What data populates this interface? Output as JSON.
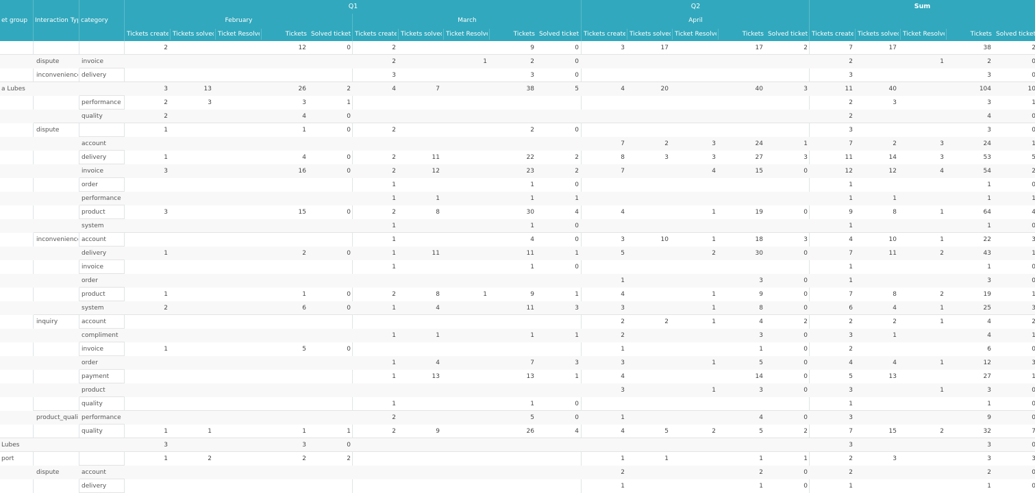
{
  "header": {
    "row_fields": [
      "et group",
      "Interaction Typ",
      "category"
    ],
    "quarters": [
      {
        "label": "Q1"
      },
      {
        "label": "Q2"
      },
      {
        "label": "Sum"
      }
    ],
    "months": [
      "February",
      "March",
      "April"
    ],
    "measures": [
      "Tickets created",
      "Tickets solved -",
      "Ticket Resolved",
      "Tickets",
      "Solved tickets"
    ]
  },
  "rows": [
    {
      "g": "",
      "t": "",
      "c": "",
      "v": [
        [
          "2",
          "",
          "",
          "12",
          "0"
        ],
        [
          "2",
          "",
          "",
          "9",
          "0"
        ],
        [
          "3",
          "17",
          "",
          "17",
          "2"
        ],
        [
          "7",
          "17",
          "",
          "38",
          "2"
        ]
      ]
    },
    {
      "g": "",
      "t": "dispute",
      "c": "invoice",
      "v": [
        [
          "",
          "",
          "",
          "",
          ""
        ],
        [
          "2",
          "",
          "1",
          "2",
          "0"
        ],
        [
          "",
          "",
          "",
          "",
          ""
        ],
        [
          "2",
          "",
          "1",
          "2",
          "0"
        ]
      ]
    },
    {
      "g": "",
      "t": "inconvenience",
      "c": "delivery",
      "v": [
        [
          "",
          "",
          "",
          "",
          ""
        ],
        [
          "3",
          "",
          "",
          "3",
          "0"
        ],
        [
          "",
          "",
          "",
          "",
          ""
        ],
        [
          "3",
          "",
          "",
          "3",
          "0"
        ]
      ]
    },
    {
      "g": "a Lubes",
      "t": "",
      "c": "",
      "v": [
        [
          "3",
          "13",
          "",
          "26",
          "2"
        ],
        [
          "4",
          "7",
          "",
          "38",
          "5"
        ],
        [
          "4",
          "20",
          "",
          "40",
          "3"
        ],
        [
          "11",
          "40",
          "",
          "104",
          "10"
        ]
      ]
    },
    {
      "g": "",
      "t": "",
      "c": "performance",
      "v": [
        [
          "2",
          "3",
          "",
          "3",
          "1"
        ],
        [
          "",
          "",
          "",
          "",
          ""
        ],
        [
          "",
          "",
          "",
          "",
          ""
        ],
        [
          "2",
          "3",
          "",
          "3",
          "1"
        ]
      ]
    },
    {
      "g": "",
      "t": "",
      "c": "quality",
      "v": [
        [
          "2",
          "",
          "",
          "4",
          "0"
        ],
        [
          "",
          "",
          "",
          "",
          ""
        ],
        [
          "",
          "",
          "",
          "",
          ""
        ],
        [
          "2",
          "",
          "",
          "4",
          "0"
        ]
      ]
    },
    {
      "g": "",
      "t": "dispute",
      "c": "",
      "v": [
        [
          "1",
          "",
          "",
          "1",
          "0"
        ],
        [
          "2",
          "",
          "",
          "2",
          "0"
        ],
        [
          "",
          "",
          "",
          "",
          ""
        ],
        [
          "3",
          "",
          "",
          "3",
          "0"
        ]
      ]
    },
    {
      "g": "",
      "t": "",
      "c": "account",
      "v": [
        [
          "",
          "",
          "",
          "",
          ""
        ],
        [
          "",
          "",
          "",
          "",
          ""
        ],
        [
          "7",
          "2",
          "3",
          "24",
          "1"
        ],
        [
          "7",
          "2",
          "3",
          "24",
          "1"
        ]
      ]
    },
    {
      "g": "",
      "t": "",
      "c": "delivery",
      "v": [
        [
          "1",
          "",
          "",
          "4",
          "0"
        ],
        [
          "2",
          "11",
          "",
          "22",
          "2"
        ],
        [
          "8",
          "3",
          "3",
          "27",
          "3"
        ],
        [
          "11",
          "14",
          "3",
          "53",
          "5"
        ]
      ]
    },
    {
      "g": "",
      "t": "",
      "c": "invoice",
      "v": [
        [
          "3",
          "",
          "",
          "16",
          "0"
        ],
        [
          "2",
          "12",
          "",
          "23",
          "2"
        ],
        [
          "7",
          "",
          "4",
          "15",
          "0"
        ],
        [
          "12",
          "12",
          "4",
          "54",
          "2"
        ]
      ]
    },
    {
      "g": "",
      "t": "",
      "c": "order",
      "v": [
        [
          "",
          "",
          "",
          "",
          ""
        ],
        [
          "1",
          "",
          "",
          "1",
          "0"
        ],
        [
          "",
          "",
          "",
          "",
          ""
        ],
        [
          "1",
          "",
          "",
          "1",
          "0"
        ]
      ]
    },
    {
      "g": "",
      "t": "",
      "c": "performance",
      "v": [
        [
          "",
          "",
          "",
          "",
          ""
        ],
        [
          "1",
          "1",
          "",
          "1",
          "1"
        ],
        [
          "",
          "",
          "",
          "",
          ""
        ],
        [
          "1",
          "1",
          "",
          "1",
          "1"
        ]
      ]
    },
    {
      "g": "",
      "t": "",
      "c": "product",
      "v": [
        [
          "3",
          "",
          "",
          "15",
          "0"
        ],
        [
          "2",
          "8",
          "",
          "30",
          "4"
        ],
        [
          "4",
          "",
          "1",
          "19",
          "0"
        ],
        [
          "9",
          "8",
          "1",
          "64",
          "4"
        ]
      ]
    },
    {
      "g": "",
      "t": "",
      "c": "system",
      "v": [
        [
          "",
          "",
          "",
          "",
          ""
        ],
        [
          "1",
          "",
          "",
          "1",
          "0"
        ],
        [
          "",
          "",
          "",
          "",
          ""
        ],
        [
          "1",
          "",
          "",
          "1",
          "0"
        ]
      ]
    },
    {
      "g": "",
      "t": "inconvenience",
      "c": "account",
      "v": [
        [
          "",
          "",
          "",
          "",
          ""
        ],
        [
          "1",
          "",
          "",
          "4",
          "0"
        ],
        [
          "3",
          "10",
          "1",
          "18",
          "3"
        ],
        [
          "4",
          "10",
          "1",
          "22",
          "3"
        ]
      ]
    },
    {
      "g": "",
      "t": "",
      "c": "delivery",
      "v": [
        [
          "1",
          "",
          "",
          "2",
          "0"
        ],
        [
          "1",
          "11",
          "",
          "11",
          "1"
        ],
        [
          "5",
          "",
          "2",
          "30",
          "0"
        ],
        [
          "7",
          "11",
          "2",
          "43",
          "1"
        ]
      ]
    },
    {
      "g": "",
      "t": "",
      "c": "invoice",
      "v": [
        [
          "",
          "",
          "",
          "",
          ""
        ],
        [
          "1",
          "",
          "",
          "1",
          "0"
        ],
        [
          "",
          "",
          "",
          "",
          ""
        ],
        [
          "1",
          "",
          "",
          "1",
          "0"
        ]
      ]
    },
    {
      "g": "",
      "t": "",
      "c": "order",
      "v": [
        [
          "",
          "",
          "",
          "",
          ""
        ],
        [
          "",
          "",
          "",
          "",
          ""
        ],
        [
          "1",
          "",
          "",
          "3",
          "0"
        ],
        [
          "1",
          "",
          "",
          "3",
          "0"
        ]
      ]
    },
    {
      "g": "",
      "t": "",
      "c": "product",
      "v": [
        [
          "1",
          "",
          "",
          "1",
          "0"
        ],
        [
          "2",
          "8",
          "1",
          "9",
          "1"
        ],
        [
          "4",
          "",
          "1",
          "9",
          "0"
        ],
        [
          "7",
          "8",
          "2",
          "19",
          "1"
        ]
      ]
    },
    {
      "g": "",
      "t": "",
      "c": "system",
      "v": [
        [
          "2",
          "",
          "",
          "6",
          "0"
        ],
        [
          "1",
          "4",
          "",
          "11",
          "3"
        ],
        [
          "3",
          "",
          "1",
          "8",
          "0"
        ],
        [
          "6",
          "4",
          "1",
          "25",
          "3"
        ]
      ]
    },
    {
      "g": "",
      "t": "inquiry",
      "c": "account",
      "v": [
        [
          "",
          "",
          "",
          "",
          ""
        ],
        [
          "",
          "",
          "",
          "",
          ""
        ],
        [
          "2",
          "2",
          "1",
          "4",
          "2"
        ],
        [
          "2",
          "2",
          "1",
          "4",
          "2"
        ]
      ]
    },
    {
      "g": "",
      "t": "",
      "c": "compliment",
      "v": [
        [
          "",
          "",
          "",
          "",
          ""
        ],
        [
          "1",
          "1",
          "",
          "1",
          "1"
        ],
        [
          "2",
          "",
          "",
          "3",
          "0"
        ],
        [
          "3",
          "1",
          "",
          "4",
          "1"
        ]
      ]
    },
    {
      "g": "",
      "t": "",
      "c": "invoice",
      "v": [
        [
          "1",
          "",
          "",
          "5",
          "0"
        ],
        [
          "",
          "",
          "",
          "",
          ""
        ],
        [
          "1",
          "",
          "",
          "1",
          "0"
        ],
        [
          "2",
          "",
          "",
          "6",
          "0"
        ]
      ]
    },
    {
      "g": "",
      "t": "",
      "c": "order",
      "v": [
        [
          "",
          "",
          "",
          "",
          ""
        ],
        [
          "1",
          "4",
          "",
          "7",
          "3"
        ],
        [
          "3",
          "",
          "1",
          "5",
          "0"
        ],
        [
          "4",
          "4",
          "1",
          "12",
          "3"
        ]
      ]
    },
    {
      "g": "",
      "t": "",
      "c": "payment",
      "v": [
        [
          "",
          "",
          "",
          "",
          ""
        ],
        [
          "1",
          "13",
          "",
          "13",
          "1"
        ],
        [
          "4",
          "",
          "",
          "14",
          "0"
        ],
        [
          "5",
          "13",
          "",
          "27",
          "1"
        ]
      ]
    },
    {
      "g": "",
      "t": "",
      "c": "product",
      "v": [
        [
          "",
          "",
          "",
          "",
          ""
        ],
        [
          "",
          "",
          "",
          "",
          ""
        ],
        [
          "3",
          "",
          "1",
          "3",
          "0"
        ],
        [
          "3",
          "",
          "1",
          "3",
          "0"
        ]
      ]
    },
    {
      "g": "",
      "t": "",
      "c": "quality",
      "v": [
        [
          "",
          "",
          "",
          "",
          ""
        ],
        [
          "1",
          "",
          "",
          "1",
          "0"
        ],
        [
          "",
          "",
          "",
          "",
          ""
        ],
        [
          "1",
          "",
          "",
          "1",
          "0"
        ]
      ]
    },
    {
      "g": "",
      "t": "product_quali...",
      "c": "performance",
      "v": [
        [
          "",
          "",
          "",
          "",
          ""
        ],
        [
          "2",
          "",
          "",
          "5",
          "0"
        ],
        [
          "1",
          "",
          "",
          "4",
          "0"
        ],
        [
          "3",
          "",
          "",
          "9",
          "0"
        ]
      ]
    },
    {
      "g": "",
      "t": "",
      "c": "quality",
      "v": [
        [
          "1",
          "1",
          "",
          "1",
          "1"
        ],
        [
          "2",
          "9",
          "",
          "26",
          "4"
        ],
        [
          "4",
          "5",
          "2",
          "5",
          "2"
        ],
        [
          "7",
          "15",
          "2",
          "32",
          "7"
        ]
      ]
    },
    {
      "g": "Lubes",
      "t": "",
      "c": "",
      "v": [
        [
          "3",
          "",
          "",
          "3",
          "0"
        ],
        [
          "",
          "",
          "",
          "",
          ""
        ],
        [
          "",
          "",
          "",
          "",
          ""
        ],
        [
          "3",
          "",
          "",
          "3",
          "0"
        ]
      ]
    },
    {
      "g": "port",
      "t": "",
      "c": "",
      "v": [
        [
          "1",
          "2",
          "",
          "2",
          "2"
        ],
        [
          "",
          "",
          "",
          "",
          ""
        ],
        [
          "1",
          "1",
          "",
          "1",
          "1"
        ],
        [
          "2",
          "3",
          "",
          "3",
          "3"
        ]
      ]
    },
    {
      "g": "",
      "t": "dispute",
      "c": "account",
      "v": [
        [
          "",
          "",
          "",
          "",
          ""
        ],
        [
          "",
          "",
          "",
          "",
          ""
        ],
        [
          "2",
          "",
          "",
          "2",
          "0"
        ],
        [
          "2",
          "",
          "",
          "2",
          "0"
        ]
      ]
    },
    {
      "g": "",
      "t": "",
      "c": "delivery",
      "v": [
        [
          "",
          "",
          "",
          "",
          ""
        ],
        [
          "",
          "",
          "",
          "",
          ""
        ],
        [
          "1",
          "",
          "",
          "1",
          "0"
        ],
        [
          "1",
          "",
          "",
          "1",
          "0"
        ]
      ]
    }
  ]
}
